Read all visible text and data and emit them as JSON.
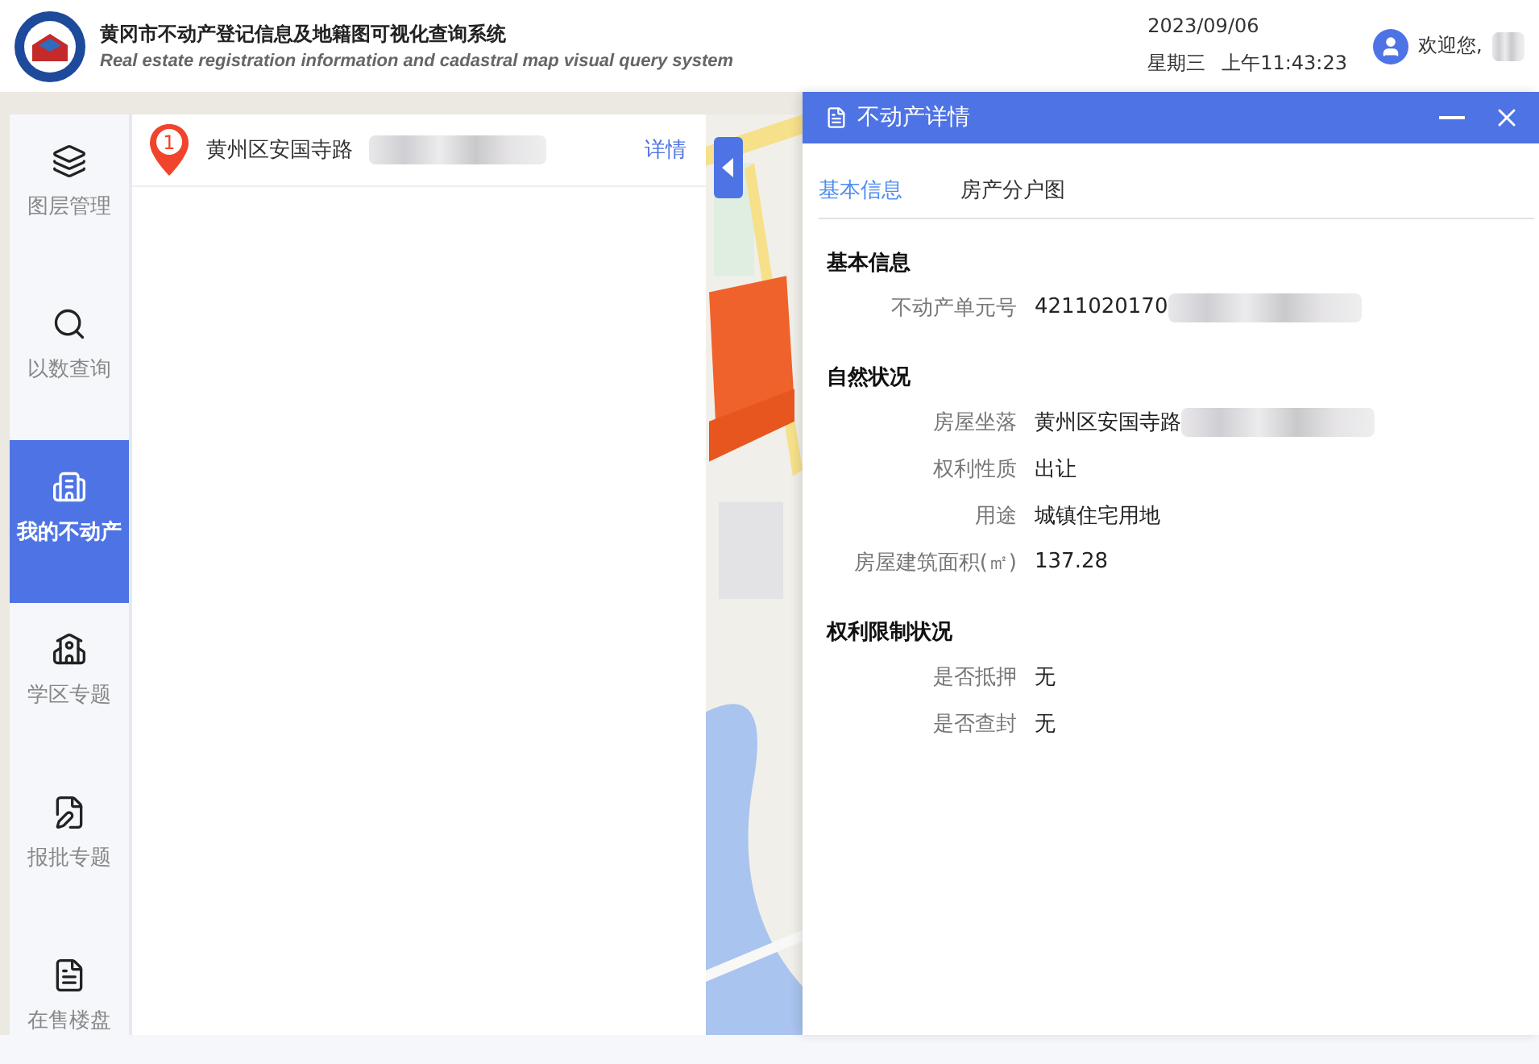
{
  "header": {
    "title": "黄冈市不动产登记信息及地籍图可视化查询系统",
    "subtitle": "Real estate registration information and cadastral map visual query system",
    "date": "2023/09/06",
    "weekday": "星期三",
    "time": "上午11:43:23",
    "greeting": "欢迎您,"
  },
  "sidebar": {
    "items": [
      {
        "label": "图层管理",
        "selected": false
      },
      {
        "label": "以数查询",
        "selected": false
      },
      {
        "label": "我的不动产",
        "selected": true
      },
      {
        "label": "学区专题",
        "selected": false
      },
      {
        "label": "报批专题",
        "selected": false
      },
      {
        "label": "在售楼盘",
        "selected": false
      }
    ]
  },
  "results": [
    {
      "index": "1",
      "address": "黄州区安国寺路",
      "redacted": true,
      "action": "详情"
    }
  ],
  "detail": {
    "title": "不动产详情",
    "tabs": [
      {
        "label": "基本信息",
        "selected": true
      },
      {
        "label": "房产分户图",
        "selected": false
      }
    ],
    "sections": [
      {
        "title": "基本信息",
        "fields": [
          {
            "label": "不动产单元号",
            "value": "4211020170",
            "redacted": true
          }
        ]
      },
      {
        "title": "自然状况",
        "fields": [
          {
            "label": "房屋坐落",
            "value": "黄州区安国寺路",
            "redacted": true
          },
          {
            "label": "权利性质",
            "value": "出让",
            "redacted": false
          },
          {
            "label": "用途",
            "value": "城镇住宅用地",
            "redacted": false
          },
          {
            "label": "房屋建筑面积(㎡)",
            "value": "137.28",
            "redacted": false
          }
        ]
      },
      {
        "title": "权利限制状况",
        "fields": [
          {
            "label": "是否抵押",
            "value": "无",
            "redacted": false
          },
          {
            "label": "是否查封",
            "value": "无",
            "redacted": false
          }
        ]
      }
    ]
  }
}
